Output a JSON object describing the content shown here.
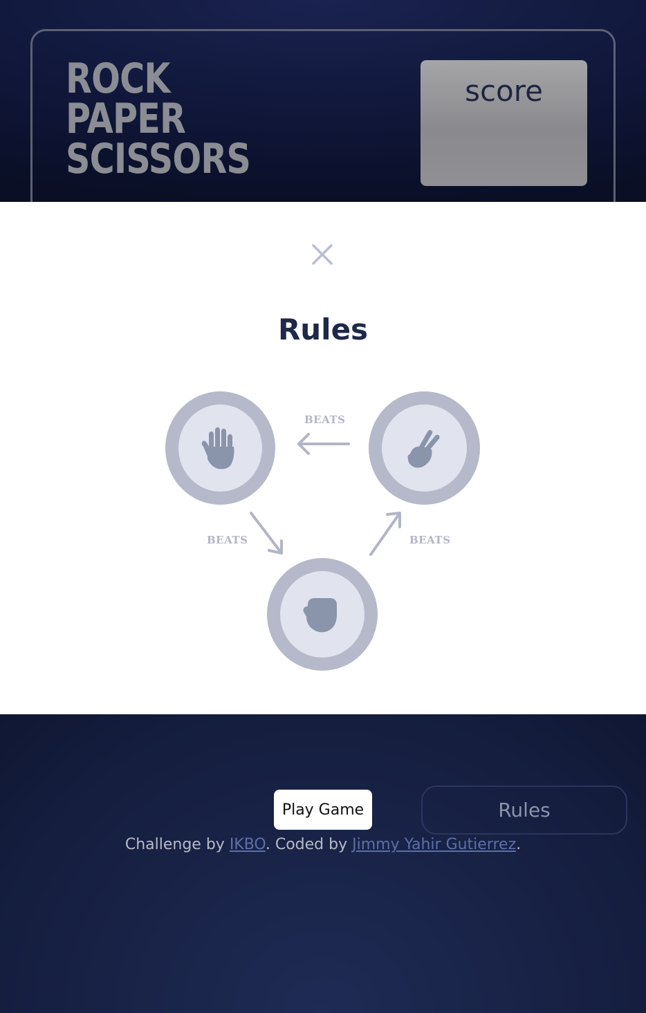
{
  "header": {
    "title_lines": [
      "ROCK",
      "PAPER",
      "SCISSORS"
    ],
    "score_label": "score"
  },
  "modal": {
    "title": "Rules",
    "close_icon": "close-icon",
    "beats_label_top": "BEATS",
    "beats_label_left": "BEATS",
    "beats_label_right": "BEATS",
    "tokens": [
      {
        "name": "paper",
        "icon": "paper-hand-icon"
      },
      {
        "name": "scissors",
        "icon": "scissors-hand-icon"
      },
      {
        "name": "rock",
        "icon": "rock-fist-icon"
      }
    ]
  },
  "footer": {
    "play_label": "Play Game",
    "rules_label": "Rules",
    "attribution_prefix": "Challenge by ",
    "attribution_author1": "IKBO",
    "attribution_middle": ". Coded by ",
    "attribution_author2": "Jimmy Yahir Gutierrez",
    "attribution_suffix": "."
  },
  "colors": {
    "modal_background": "#ffffff",
    "token_ring": "#b5b9c9",
    "token_inner": "#e1e3ee",
    "hand_icon": "#8a94ab",
    "title_text": "#1e2948"
  }
}
